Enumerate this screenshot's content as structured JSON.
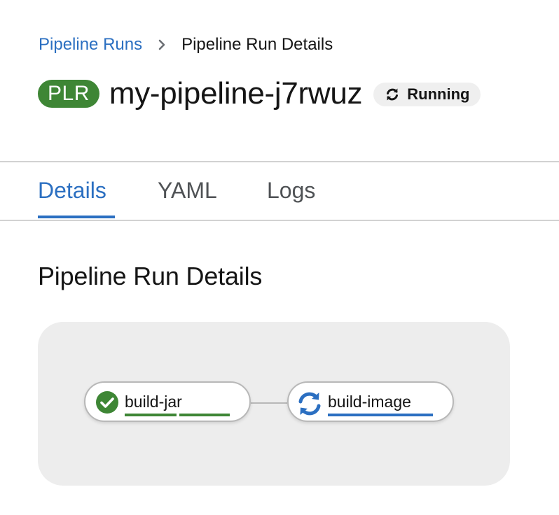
{
  "breadcrumb": {
    "parent": "Pipeline Runs",
    "current": "Pipeline Run Details"
  },
  "header": {
    "badge": "PLR",
    "title": "my-pipeline-j7rwuz",
    "status": "Running"
  },
  "tabs": [
    {
      "label": "Details",
      "active": true
    },
    {
      "label": "YAML",
      "active": false
    },
    {
      "label": "Logs",
      "active": false
    }
  ],
  "section": {
    "heading": "Pipeline Run Details"
  },
  "graph": {
    "tasks": [
      {
        "name": "build-jar",
        "status": "succeeded",
        "icon": "check-circle-icon",
        "steps_completed": 2,
        "steps_total": 2
      },
      {
        "name": "build-image",
        "status": "running",
        "icon": "sync-icon",
        "steps_completed": 1,
        "steps_total": 1
      }
    ]
  },
  "colors": {
    "link": "#2b6fc1",
    "success": "#3e8635",
    "running": "#2b6fc1",
    "graph_bg": "#ededed"
  }
}
